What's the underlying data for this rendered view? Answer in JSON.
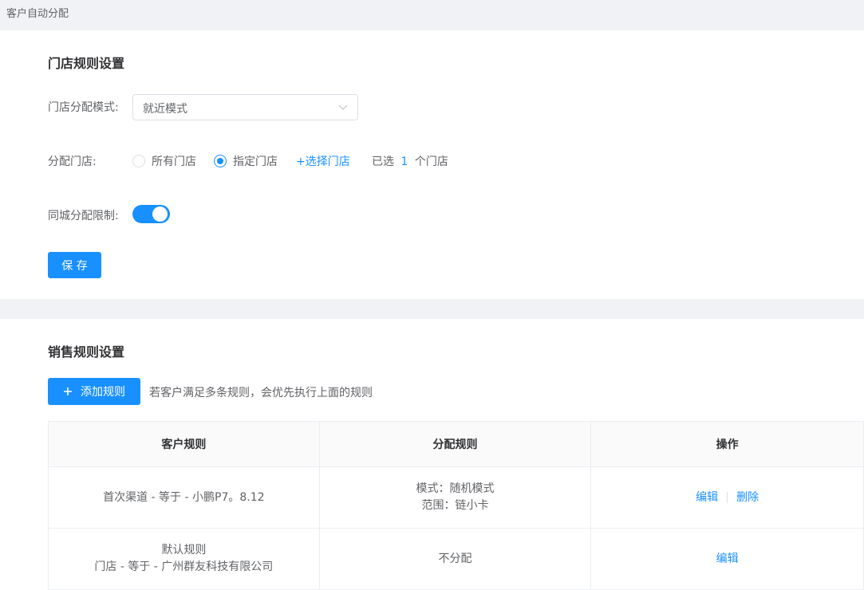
{
  "breadcrumb": "客户自动分配",
  "store_rules": {
    "title": "门店规则设置",
    "mode_label": "门店分配模式:",
    "mode_value": "就近模式",
    "assign_label": "分配门店:",
    "radio_all": "所有门店",
    "radio_specific": "指定门店",
    "select_stores": "+选择门店",
    "selected_prefix": "已选",
    "selected_count": "1",
    "selected_suffix": "个门店",
    "city_limit_label": "同城分配限制:",
    "city_limit_on": true,
    "save_label": "保 存"
  },
  "sales_rules": {
    "title": "销售规则设置",
    "add_label": "添加规则",
    "hint": "若客户满足多条规则，会优先执行上面的规则",
    "columns": [
      "客户规则",
      "分配规则",
      "操作"
    ],
    "rows": [
      {
        "customer_rule": [
          "首次渠道 - 等于 - 小鹏P7。8.12"
        ],
        "assign_rule": [
          "模式：随机模式",
          "范围：链小卡"
        ],
        "actions": [
          "编辑",
          "删除"
        ]
      },
      {
        "customer_rule": [
          "默认规则",
          "门店 - 等于 - 广州群友科技有限公司"
        ],
        "assign_rule": [
          "不分配"
        ],
        "actions": [
          "编辑"
        ]
      }
    ]
  },
  "colors": {
    "primary": "#1890ff",
    "text": "#606266",
    "title": "#303133",
    "bg": "#f0f2f5"
  }
}
